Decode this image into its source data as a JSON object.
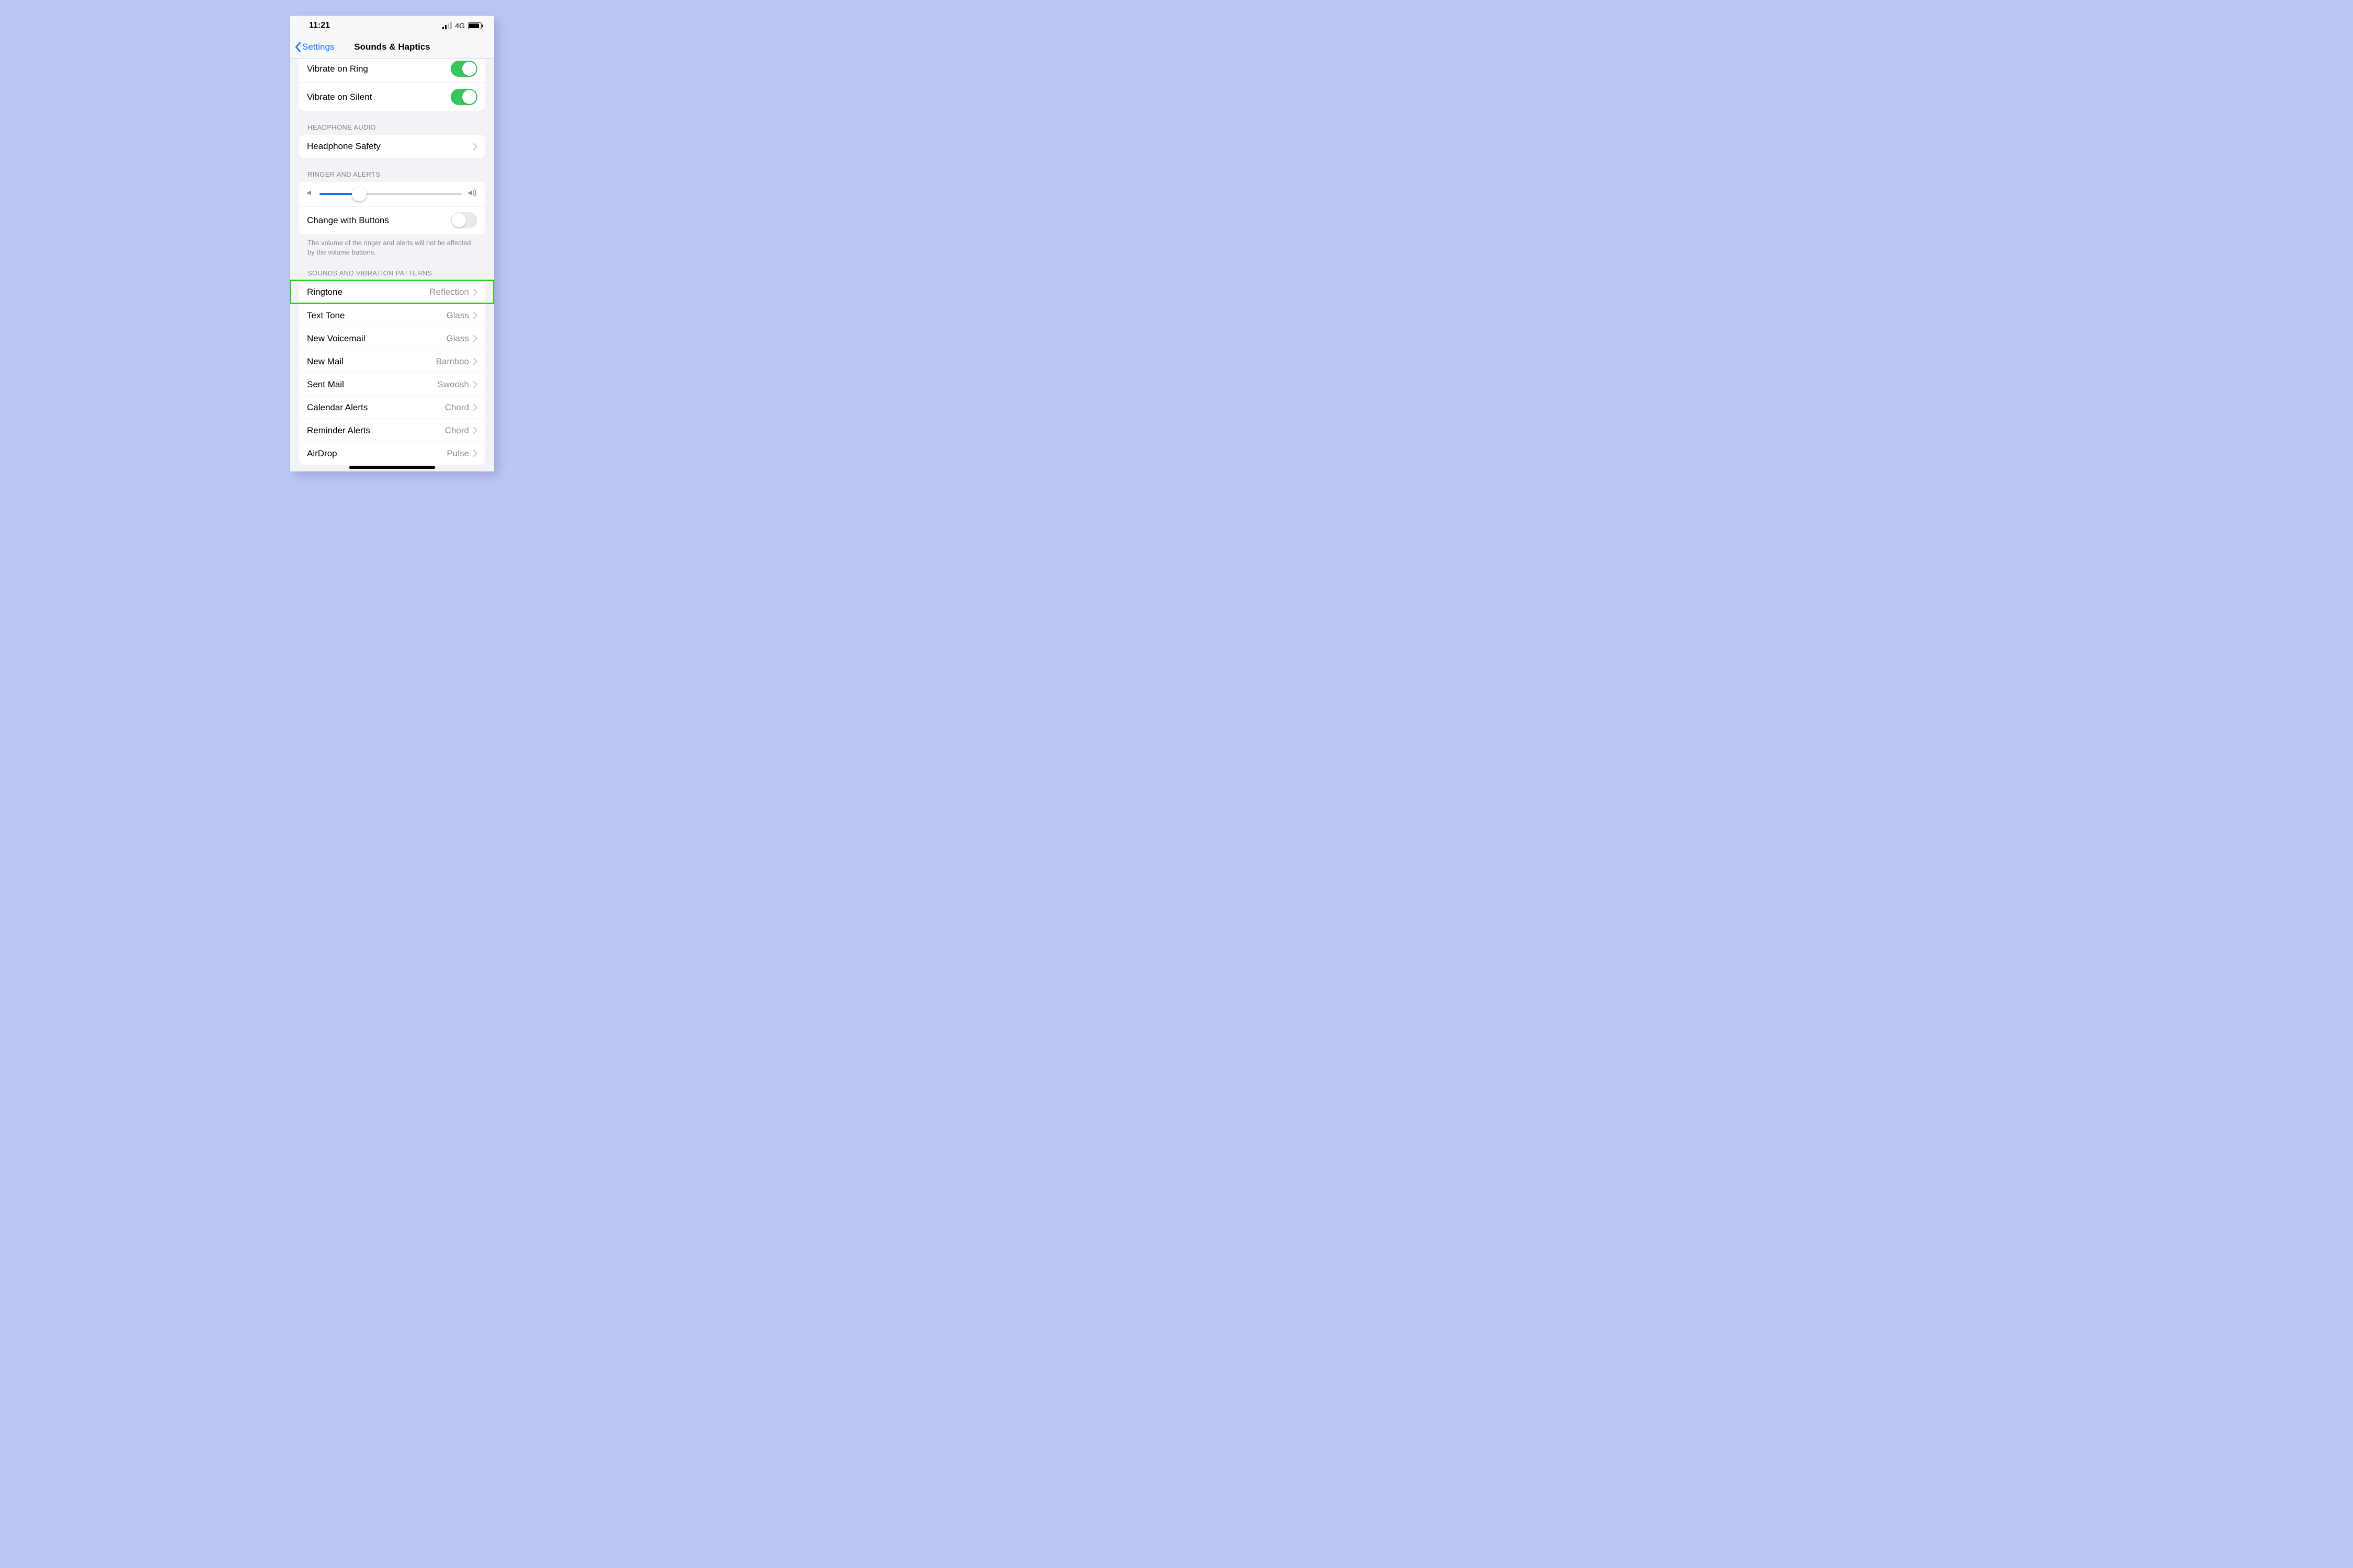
{
  "status": {
    "time": "11:21",
    "network": "4G"
  },
  "nav": {
    "back": "Settings",
    "title": "Sounds & Haptics"
  },
  "vibrate": {
    "ring_label": "Vibrate on Ring",
    "silent_label": "Vibrate on Silent",
    "ring_on": true,
    "silent_on": true
  },
  "headphone": {
    "header": "HEADPHONE AUDIO",
    "safety_label": "Headphone Safety"
  },
  "ringer": {
    "header": "RINGER AND ALERTS",
    "slider_percent": 28,
    "change_label": "Change with Buttons",
    "change_on": false,
    "footer": "The volume of the ringer and alerts will not be affected by the volume buttons."
  },
  "sounds": {
    "header": "SOUNDS AND VIBRATION PATTERNS",
    "items": [
      {
        "label": "Ringtone",
        "value": "Reflection"
      },
      {
        "label": "Text Tone",
        "value": "Glass"
      },
      {
        "label": "New Voicemail",
        "value": "Glass"
      },
      {
        "label": "New Mail",
        "value": "Bamboo"
      },
      {
        "label": "Sent Mail",
        "value": "Swoosh"
      },
      {
        "label": "Calendar Alerts",
        "value": "Chord"
      },
      {
        "label": "Reminder Alerts",
        "value": "Chord"
      },
      {
        "label": "AirDrop",
        "value": "Pulse"
      }
    ]
  },
  "highlight_row": 0,
  "colors": {
    "accent": "#0b79ff",
    "toggle_on": "#34c759",
    "highlight": "#22d11a"
  }
}
